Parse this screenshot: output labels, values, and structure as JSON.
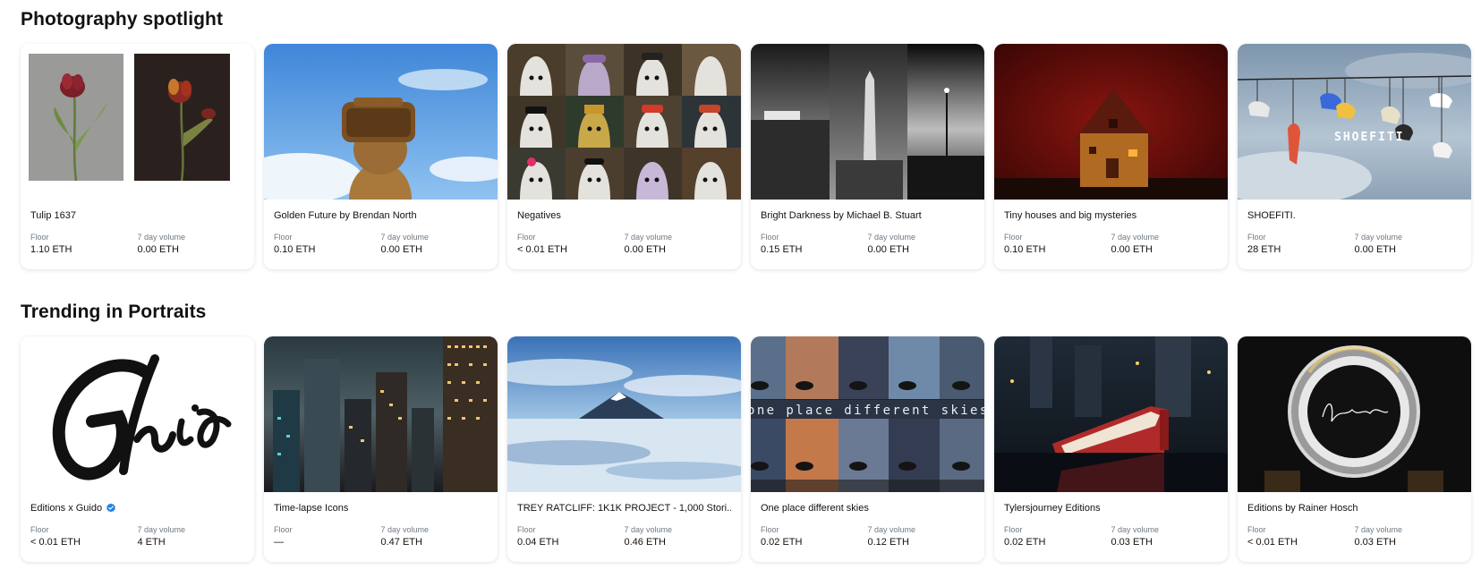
{
  "sections": [
    {
      "title": "Photography spotlight",
      "cards": [
        {
          "name": "Tulip 1637",
          "floor_label": "Floor",
          "floor": "1.10 ETH",
          "volume_label": "7 day volume",
          "volume": "0.00 ETH"
        },
        {
          "name": "Golden Future by Brendan North",
          "floor_label": "Floor",
          "floor": "0.10 ETH",
          "volume_label": "7 day volume",
          "volume": "0.00 ETH"
        },
        {
          "name": "Negatives",
          "floor_label": "Floor",
          "floor": "< 0.01 ETH",
          "volume_label": "7 day volume",
          "volume": "0.00 ETH"
        },
        {
          "name": "Bright Darkness by Michael B. Stuart",
          "floor_label": "Floor",
          "floor": "0.15 ETH",
          "volume_label": "7 day volume",
          "volume": "0.00 ETH"
        },
        {
          "name": "Tiny houses and big mysteries",
          "floor_label": "Floor",
          "floor": "0.10 ETH",
          "volume_label": "7 day volume",
          "volume": "0.00 ETH"
        },
        {
          "name": "SHOEFITI.",
          "floor_label": "Floor",
          "floor": "28 ETH",
          "volume_label": "7 day volume",
          "volume": "0.00 ETH",
          "image_text": "SHOEFITI"
        }
      ]
    },
    {
      "title": "Trending in Portraits",
      "cards": [
        {
          "name": "Editions x Guido",
          "verified": true,
          "floor_label": "Floor",
          "floor": "< 0.01 ETH",
          "volume_label": "7 day volume",
          "volume": "4 ETH"
        },
        {
          "name": "Time-lapse Icons",
          "floor_label": "Floor",
          "floor": "—",
          "volume_label": "7 day volume",
          "volume": "0.47 ETH"
        },
        {
          "name": "TREY RATCLIFF: 1K1K PROJECT - 1,000 Stori...",
          "floor_label": "Floor",
          "floor": "0.04 ETH",
          "volume_label": "7 day volume",
          "volume": "0.46 ETH"
        },
        {
          "name": "One place different skies",
          "floor_label": "Floor",
          "floor": "0.02 ETH",
          "volume_label": "7 day volume",
          "volume": "0.12 ETH",
          "image_text": "one place different skies"
        },
        {
          "name": "Tylersjourney Editions",
          "floor_label": "Floor",
          "floor": "0.02 ETH",
          "volume_label": "7 day volume",
          "volume": "0.03 ETH"
        },
        {
          "name": "Editions by Rainer Hosch",
          "floor_label": "Floor",
          "floor": "< 0.01 ETH",
          "volume_label": "7 day volume",
          "volume": "0.03 ETH"
        }
      ]
    }
  ],
  "colors": {
    "text": "#121212",
    "muted": "#707a83",
    "verified": "#2081e2"
  }
}
